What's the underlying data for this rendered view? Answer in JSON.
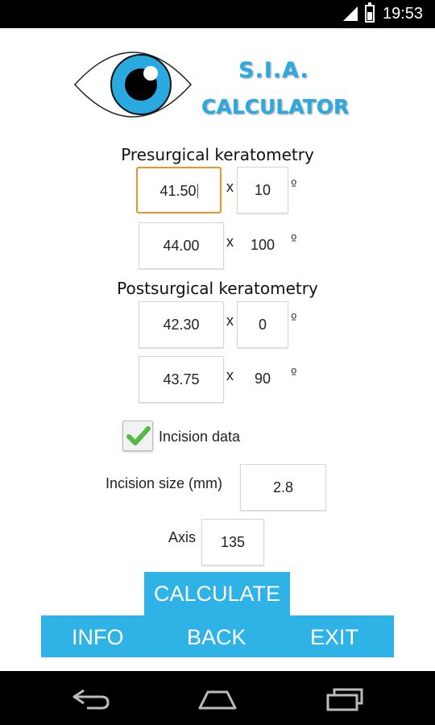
{
  "status_bar": {
    "time": "19:53"
  },
  "header": {
    "title_line1": "S.I.A.",
    "title_line2": "CALCULATOR"
  },
  "presurgical": {
    "heading": "Presurgical keratometry",
    "k1": {
      "value": "41.50",
      "axis": "10"
    },
    "k2": {
      "value": "44.00",
      "axis": "100"
    }
  },
  "postsurgical": {
    "heading": "Postsurgical keratometry",
    "k1": {
      "value": "42.30",
      "axis": "0"
    },
    "k2": {
      "value": "43.75",
      "axis": "90"
    }
  },
  "symbols": {
    "times": "x",
    "degree": "º"
  },
  "incision": {
    "checkbox_label": "Incision data",
    "checked": true,
    "size_label": "Incision size (mm)",
    "size_value": "2.8",
    "axis_label": "Axis",
    "axis_value": "135"
  },
  "buttons": {
    "calculate": "CALCULATE",
    "info": "INFO",
    "back": "BACK",
    "exit": "EXIT"
  },
  "colors": {
    "accent": "#2fb3e6",
    "focus": "#f0932b",
    "check": "#56b947"
  },
  "icons": [
    "signal-icon",
    "battery-icon",
    "eye-logo-icon",
    "checkmark-icon",
    "back-nav-icon",
    "home-nav-icon",
    "recents-nav-icon"
  ]
}
